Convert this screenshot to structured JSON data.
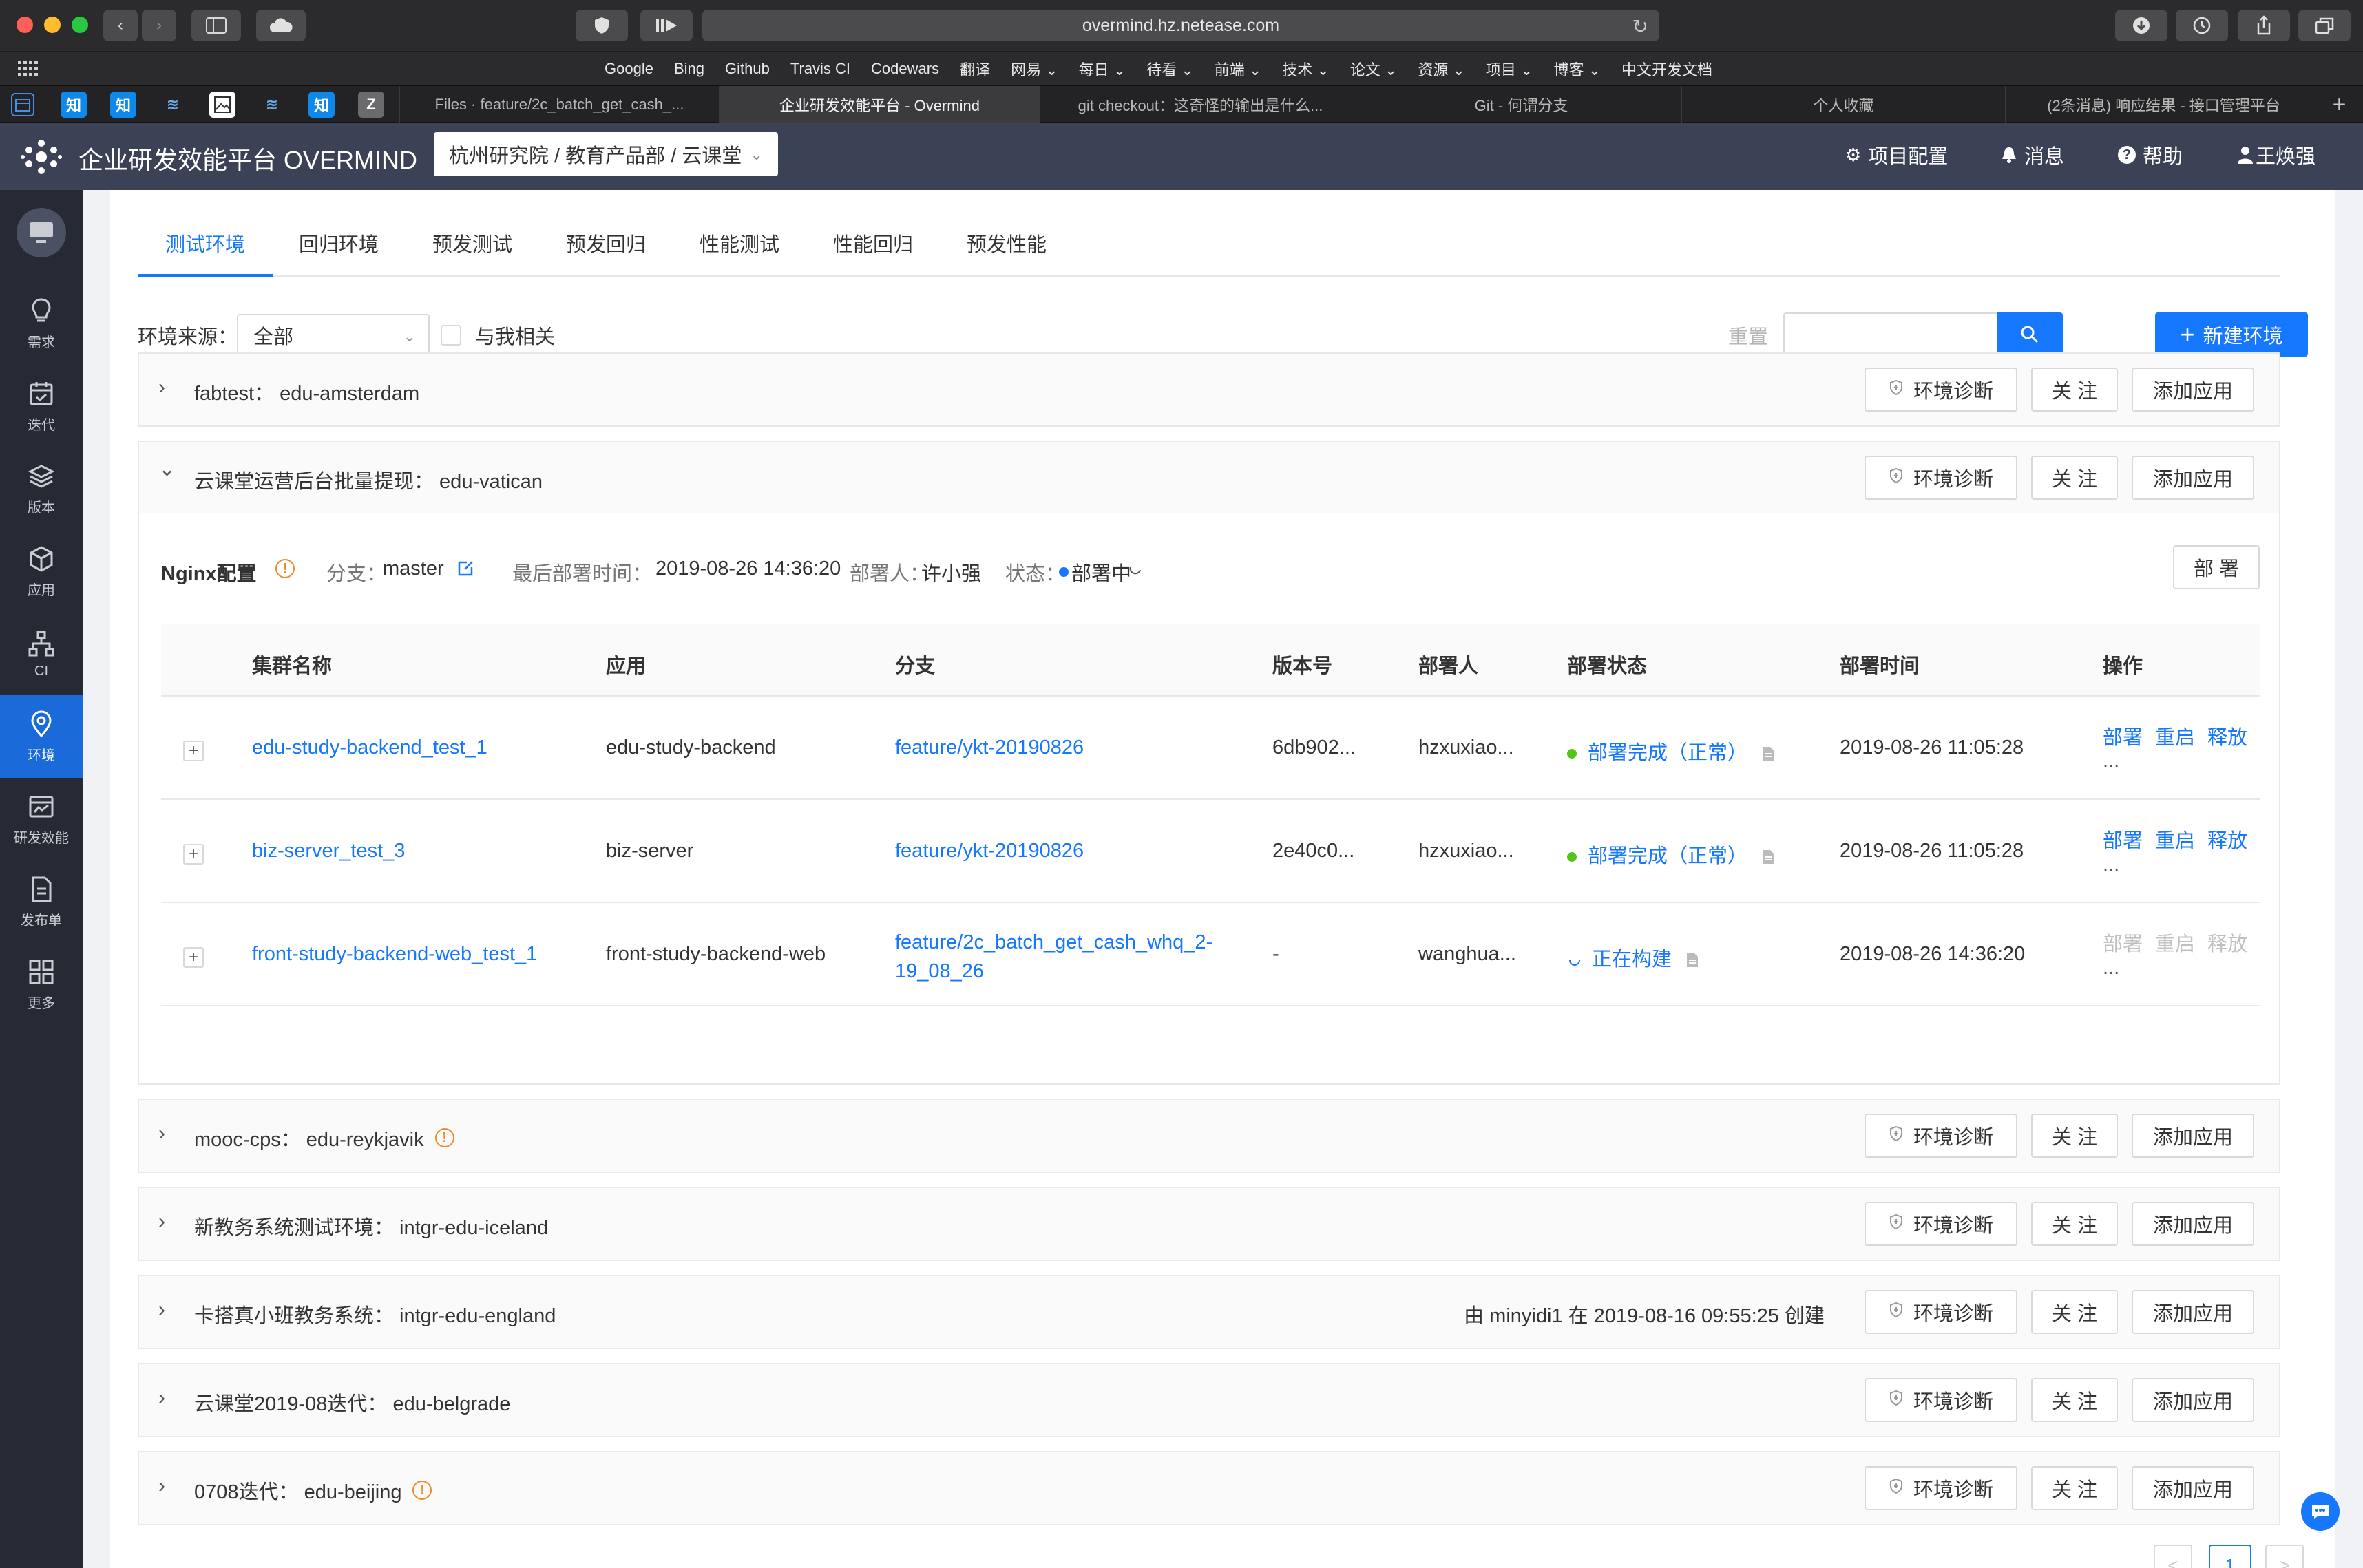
{
  "browser": {
    "url": "overmind.hz.netease.com",
    "bookmarks": [
      "Google",
      "Bing",
      "Github",
      "Travis CI",
      "Codewars",
      "翻译",
      "网易 ⌄",
      "每日 ⌄",
      "待看 ⌄",
      "前端 ⌄",
      "技术 ⌄",
      "论文 ⌄",
      "资源 ⌄",
      "项目 ⌄",
      "博客 ⌄",
      "中文开发文档"
    ],
    "pinned": [
      "知",
      "知",
      "知",
      "Z"
    ],
    "tabs": [
      "Files · feature/2c_batch_get_cash_...",
      "企业研发效能平台 - Overmind",
      "git checkout：这奇怪的输出是什么...",
      "Git - 何谓分支",
      "个人收藏",
      "(2条消息) 响应结果 - 接口管理平台"
    ],
    "new_tab": "+"
  },
  "header": {
    "title": "企业研发效能平台 OVERMIND",
    "org": "杭州研究院 / 教育产品部 / 云课堂",
    "links": [
      "项目配置",
      "消息",
      "帮助",
      "王焕强"
    ]
  },
  "sidenav": [
    "需求",
    "迭代",
    "版本",
    "应用",
    "CI",
    "环境",
    "研发效能",
    "发布单",
    "更多"
  ],
  "tabs": [
    "测试环境",
    "回归环境",
    "预发测试",
    "预发回归",
    "性能测试",
    "性能回归",
    "预发性能"
  ],
  "filter": {
    "label": "环境来源：",
    "value": "全部",
    "related": "与我相关",
    "reset": "重置",
    "new_env": "新建环境"
  },
  "actions": {
    "diagnose": "环境诊断",
    "follow": "关 注",
    "add_app": "添加应用"
  },
  "envs": [
    {
      "name": "fabtest： edu-amsterdam",
      "expanded": false,
      "warn": false
    },
    {
      "name": "云课堂运营后台批量提现： edu-vatican",
      "expanded": true,
      "warn": false
    },
    {
      "name": "mooc-cps： edu-reykjavik",
      "expanded": false,
      "warn": true
    },
    {
      "name": "新教务系统测试环境： intgr-edu-iceland",
      "expanded": false,
      "warn": false
    },
    {
      "name": "卡搭真小班教务系统： intgr-edu-england",
      "expanded": false,
      "warn": false,
      "creator": "由 minyidi1 在 2019-08-16 09:55:25 创建"
    },
    {
      "name": "云课堂2019-08迭代： edu-belgrade",
      "expanded": false,
      "warn": false
    },
    {
      "name": "0708迭代： edu-beijing",
      "expanded": false,
      "warn": true
    }
  ],
  "nginx": {
    "title": "Nginx配置",
    "branch_label": "分支：",
    "branch": "master",
    "time_label": "最后部署时间：",
    "time": "2019-08-26 14:36:20",
    "deployer_label": "部署人：",
    "deployer": "许小强",
    "status_label": "状态：",
    "status": "部署中",
    "deploy": "部 署"
  },
  "table": {
    "columns": [
      "集群名称",
      "应用",
      "分支",
      "版本号",
      "部署人",
      "部署状态",
      "部署时间",
      "操作"
    ],
    "rows": [
      {
        "cluster": "edu-study-backend_test_1",
        "app": "edu-study-backend",
        "branch": "feature/ykt-20190826",
        "branch2": "",
        "version": "6db902...",
        "deployer": "hzxuxiao...",
        "status": "部署完成（正常）",
        "time": "2019-08-26 11:05:28",
        "ops_enabled": true
      },
      {
        "cluster": "biz-server_test_3",
        "app": "biz-server",
        "branch": "feature/ykt-20190826",
        "branch2": "",
        "version": "2e40c0...",
        "deployer": "hzxuxiao...",
        "status": "部署完成（正常）",
        "time": "2019-08-26 11:05:28",
        "ops_enabled": true
      },
      {
        "cluster": "front-study-backend-web_test_1",
        "app": "front-study-backend-web",
        "branch": "feature/2c_batch_get_cash_whq_2-",
        "branch2": "19_08_26",
        "version": "-",
        "deployer": "wanghua...",
        "status": "正在构建",
        "time": "2019-08-26 14:36:20",
        "ops_enabled": false
      }
    ],
    "ops": [
      "部署",
      "重启",
      "释放"
    ],
    "more": "..."
  },
  "pager": {
    "prev": "<",
    "current": "1",
    "next": ">"
  },
  "colors": {
    "accent": "#1677ff",
    "nav_bg": "#252a35",
    "header_bg": "#3b4255",
    "success": "#52c41a",
    "warning": "#f08a2a"
  }
}
